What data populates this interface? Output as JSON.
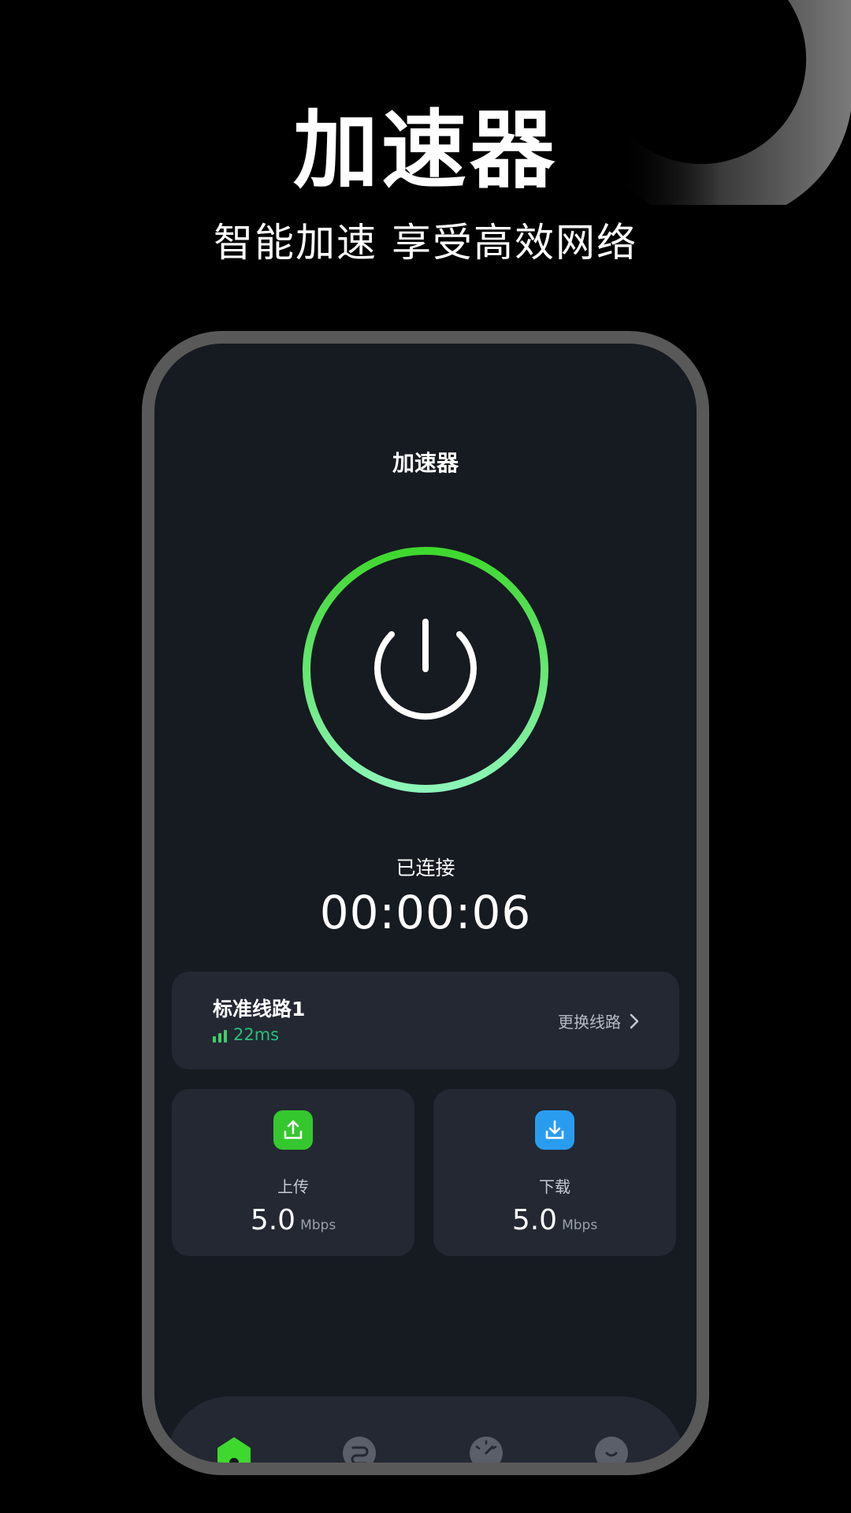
{
  "promo": {
    "title": "加速器",
    "subtitle": "智能加速 享受高效网络"
  },
  "app": {
    "title": "加速器",
    "power_icon": "power-icon",
    "status": "已连接",
    "timer": "00:00:06",
    "ring_colors": {
      "top": "#3fd82e",
      "bottom": "#8cf5b8"
    }
  },
  "route": {
    "name": "标准线路1",
    "latency": "22ms",
    "signal_icon": "signal-bars-icon",
    "switch_label": "更换线路",
    "switch_icon": "chevron-right-icon"
  },
  "speeds": [
    {
      "label": "上传",
      "value": "5.0",
      "unit": "Mbps",
      "icon": "upload-icon",
      "color": "#35c72e"
    },
    {
      "label": "下载",
      "value": "5.0",
      "unit": "Mbps",
      "icon": "download-icon",
      "color": "#2a9cf0"
    }
  ],
  "nav": {
    "items": [
      {
        "icon": "home-icon",
        "active": true,
        "color": "#3fd82e"
      },
      {
        "icon": "route-icon",
        "active": false
      },
      {
        "icon": "speedometer-icon",
        "active": false
      },
      {
        "icon": "profile-icon",
        "active": false
      }
    ]
  },
  "colors": {
    "background": "#000000",
    "screen": "#161a21",
    "card": "#232833",
    "frame": "#595959",
    "accent": "#3fd82e",
    "latency": "#25c17a"
  }
}
